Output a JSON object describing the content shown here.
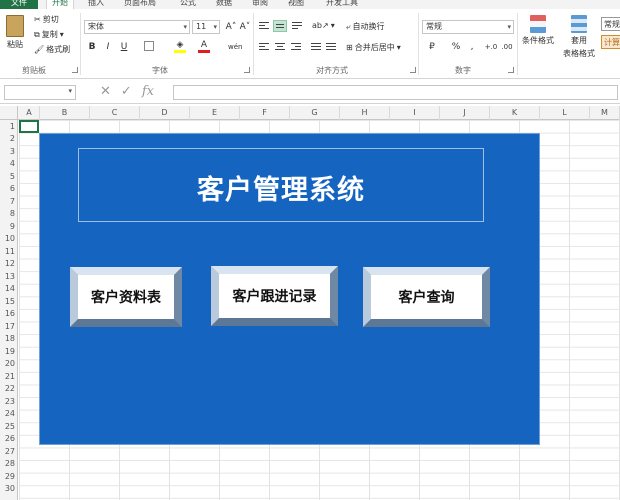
{
  "menu": {
    "tabs": [
      "文件",
      "开始",
      "插入",
      "页面布局",
      "公式",
      "数据",
      "审阅",
      "视图",
      "开发工具"
    ],
    "active": "开始"
  },
  "ribbon": {
    "clipboard": {
      "paste": "粘贴",
      "cut": "剪切",
      "copy": "复制",
      "format_painter": "格式刷",
      "group": "剪贴板"
    },
    "font": {
      "name": "宋体",
      "size": "11",
      "grow": "A˄",
      "shrink": "A˅",
      "bold": "B",
      "italic": "I",
      "underline": "U",
      "wen": "wén",
      "group": "字体"
    },
    "alignment": {
      "wrap": "自动换行",
      "merge": "合并后居中",
      "group": "对齐方式"
    },
    "number": {
      "format": "常规",
      "currency": "₽",
      "percent": "%",
      "comma": ",",
      "inc_dec": "+.0",
      "dec_dec": ".00",
      "group": "数字"
    },
    "styles": {
      "conditional": "条件格式",
      "table_format": "套用",
      "table_format2": "表格格式",
      "style_normal": "常规",
      "style_calc": "计算"
    }
  },
  "formula_bar": {
    "fx": "fx",
    "cancel": "✕",
    "enter": "✓"
  },
  "columns": [
    "A",
    "B",
    "C",
    "D",
    "E",
    "F",
    "G",
    "H",
    "I",
    "J",
    "K",
    "L",
    "M"
  ],
  "rows": [
    "1",
    "2",
    "3",
    "4",
    "5",
    "6",
    "7",
    "8",
    "9",
    "10",
    "11",
    "12",
    "13",
    "14",
    "15",
    "16",
    "17",
    "18",
    "19",
    "20",
    "21",
    "22",
    "23",
    "24",
    "25",
    "26",
    "27",
    "28",
    "29",
    "30"
  ],
  "dashboard": {
    "title": "客户管理系统",
    "buttons": [
      "客户资料表",
      "客户跟进记录",
      "客户查询"
    ]
  },
  "colors": {
    "panel": "#1565c0",
    "accent": "#217346"
  }
}
